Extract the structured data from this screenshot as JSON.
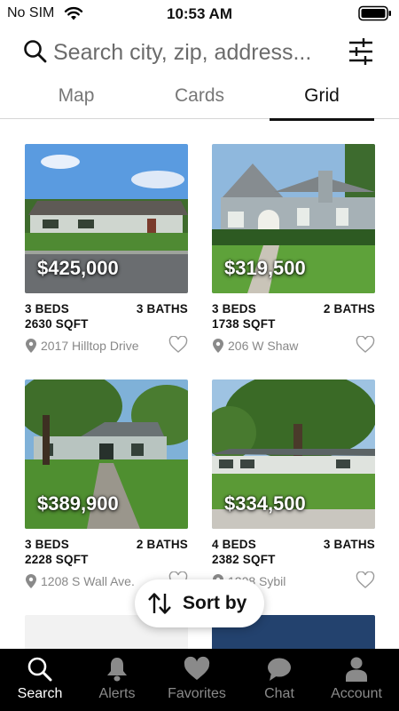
{
  "status_bar": {
    "carrier": "No SIM",
    "time": "10:53 AM"
  },
  "search": {
    "placeholder": "Search city, zip, address..."
  },
  "tabs": [
    {
      "label": "Map",
      "active": false
    },
    {
      "label": "Cards",
      "active": false
    },
    {
      "label": "Grid",
      "active": true
    }
  ],
  "listings": [
    {
      "price": "$425,000",
      "beds": "3 BEDS",
      "baths": "3 BATHS",
      "sqft": "2630 SQFT",
      "address": "2017 Hilltop Drive",
      "photo": "ranch-house-icon"
    },
    {
      "price": "$319,500",
      "beds": "3 BEDS",
      "baths": "2 BATHS",
      "sqft": "1738 SQFT",
      "address": "206 W Shaw",
      "photo": "cottage-house-icon"
    },
    {
      "price": "$389,900",
      "beds": "3 BEDS",
      "baths": "2 BATHS",
      "sqft": "2228 SQFT",
      "address": "1208 S Wall Ave.",
      "photo": "tree-house-icon"
    },
    {
      "price": "$334,500",
      "beds": "4 BEDS",
      "baths": "3 BATHS",
      "sqft": "2382 SQFT",
      "address": "1208 Sybil",
      "photo": "oak-tree-house-icon"
    }
  ],
  "sort": {
    "label": "Sort by",
    "icon": "sort-arrows-icon"
  },
  "nav": [
    {
      "label": "Search",
      "icon": "search-icon",
      "active": true
    },
    {
      "label": "Alerts",
      "icon": "bell-icon",
      "active": false
    },
    {
      "label": "Favorites",
      "icon": "heart-icon",
      "active": false
    },
    {
      "label": "Chat",
      "icon": "chat-bubble-icon",
      "active": false
    },
    {
      "label": "Account",
      "icon": "person-icon",
      "active": false
    }
  ],
  "colors": {
    "active_nav": "#ffffff",
    "inactive_nav": "#8a8a8a",
    "price_text": "#ffffff",
    "address_text": "#888888"
  }
}
